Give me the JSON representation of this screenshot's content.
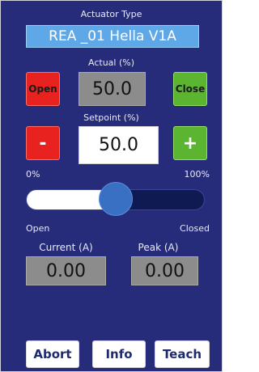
{
  "actuator": {
    "label": "Actuator Type",
    "value": "REA _01 Hella V1A"
  },
  "actual": {
    "label": "Actual (%)",
    "value": "50.0"
  },
  "setpoint": {
    "label": "Setpoint (%)",
    "value": "50.0",
    "min_label": "0%",
    "max_label": "100%"
  },
  "buttons": {
    "open": "Open",
    "close": "Close",
    "minus": "-",
    "plus": "+"
  },
  "slider": {
    "value_fraction": 0.5,
    "left_label": "Open",
    "right_label": "Closed"
  },
  "current": {
    "label": "Current (A)",
    "value": "0.00"
  },
  "peak": {
    "label": "Peak (A)",
    "value": "0.00"
  },
  "footer": {
    "abort": "Abort",
    "info": "Info",
    "teach": "Teach"
  },
  "colors": {
    "background": "#262c7a",
    "field_blue": "#5fa8e8",
    "red": "#e8231f",
    "green": "#5bb531",
    "readout_grey": "#8c8c8c",
    "slider_thumb": "#3a70c4"
  }
}
